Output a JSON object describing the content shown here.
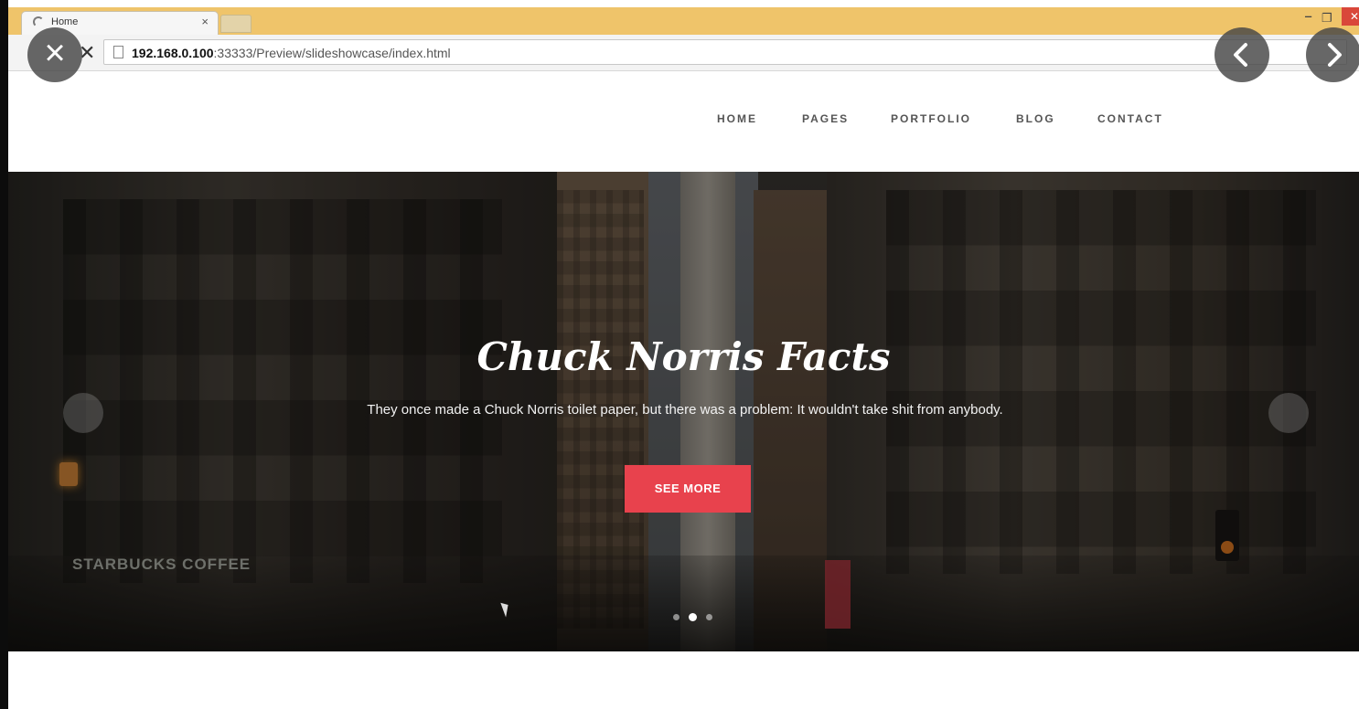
{
  "browser": {
    "tab_title": "Home",
    "tab_close": "×",
    "url_host": "192.168.0.100",
    "url_rest": ":33333/Preview/slideshowcase/index.html",
    "window_minimize": "‒",
    "window_maximize": "❐",
    "window_close": "✕",
    "stop_glyph": "✕"
  },
  "overlay": {
    "close_glyph": "×",
    "prev_icon": "chevron-left-icon",
    "next_icon": "chevron-right-icon"
  },
  "nav": {
    "items": [
      "HOME",
      "PAGES",
      "PORTFOLIO",
      "BLOG",
      "CONTACT"
    ]
  },
  "hero": {
    "title": "Chuck Norris Facts",
    "text": "They once made a Chuck Norris toilet paper, but there was a problem: It wouldn't take shit from anybody.",
    "button_label": "SEE MORE",
    "storefront_sign": "STARBUCKS COFFEE",
    "dots_count": 3,
    "active_dot": 2
  },
  "colors": {
    "titlebar": "#efc46a",
    "accent": "#e8424d",
    "nav_text": "#555555"
  }
}
